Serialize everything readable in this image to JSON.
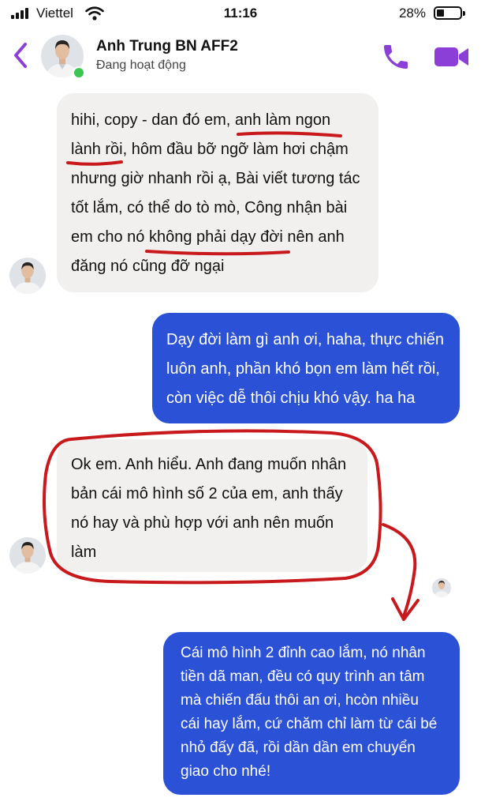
{
  "status_bar": {
    "carrier": "Viettel",
    "time": "11:16",
    "battery": "28%",
    "battery_level": 0.28
  },
  "header": {
    "contact_name": "Anh Trung BN AFF2",
    "status": "Đang hoạt động",
    "online": true
  },
  "colors": {
    "accent": "#8b3fd6",
    "incoming_bubble": "#f1f0ef",
    "outgoing_bubble": "#2b52d6",
    "annotation": "#c8191c",
    "online": "#3cc552"
  },
  "messages": [
    {
      "direction": "incoming",
      "lines": [
        "hihi, copy - dan đó em, anh làm ngon",
        "lành rồi, hôm đầu bỡ ngỡ làm hơi chậm",
        "nhưng giờ nhanh rồi ạ, Bài viết tương tác",
        "tốt lắm, có thể do tò mò, Công nhận bài",
        "em cho nó không phải dạy đời nên anh",
        "đăng nó cũng đỡ ngại"
      ]
    },
    {
      "direction": "outgoing",
      "lines": [
        "Dạy đời làm gì anh ơi, haha, thực chiến",
        "luôn anh, phần khó bọn em làm hết rồi,",
        "còn việc dễ thôi chịu khó vậy. ha ha"
      ]
    },
    {
      "direction": "incoming",
      "lines": [
        "Ok em. Anh hiểu. Anh đang muốn nhân",
        "bản cái mô hình số 2 của em, anh thấy",
        "nó hay và phù hợp với anh nên muốn",
        "làm"
      ]
    },
    {
      "direction": "outgoing",
      "lines": [
        "Cái mô hình 2 đỉnh cao lắm, nó nhân",
        "tiền dã man, đều có quy trình an tâm",
        "mà chiến đấu thôi an ơi, hcòn nhiều",
        "cái hay lắm, cứ chăm chỉ làm từ cái bé",
        "nhỏ đấy đã, rồi dần dần em chuyển",
        "giao cho nhé!"
      ]
    }
  ]
}
